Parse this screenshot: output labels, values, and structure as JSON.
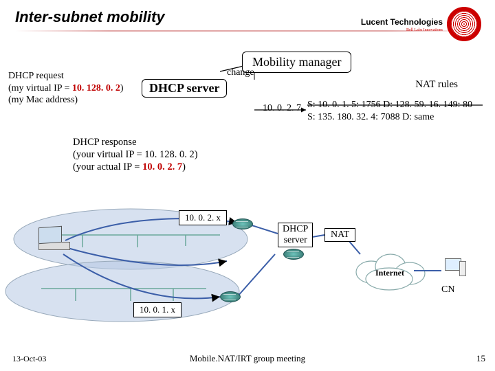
{
  "title": "Inter-subnet mobility",
  "logo": {
    "text": "Lucent Technologies",
    "sub": "Bell Labs Innovations"
  },
  "mobility_box": "Mobility manager",
  "dhcp_box": "DHCP server",
  "change_label": "change",
  "dhcp_request": {
    "l1": "DHCP request",
    "l2a": "(my virtual IP = ",
    "l2b_red": "10. 128. 0. 2",
    "l2c": ")",
    "l3": "(my Mac address)"
  },
  "nat_rules_label": "NAT rules",
  "nat_lines": {
    "l1": "S: 10. 0. 1. 5: 1756  D: 128. 59. 16. 149: 80",
    "l2": "S: 135. 180. 32. 4: 7088  D: same"
  },
  "ip_addr": "10. 0. 2. 7",
  "dhcp_response": {
    "l1": "DHCP response",
    "l2": "(your virtual IP = 10. 128. 0. 2)",
    "l3a": "(your actual IP = ",
    "l3b_red": "10. 0. 2. 7",
    "l3c": ")"
  },
  "subnets": {
    "s1": "10. 0. 2. x",
    "s2": "10. 0. 1. x"
  },
  "dhcp_srv": {
    "l1": "DHCP",
    "l2": "server"
  },
  "nat_box": "NAT",
  "internet": "Internet",
  "cn": "CN",
  "footer": {
    "date": "13-Oct-03",
    "center": "Mobile.NAT/IRT group meeting",
    "page": "15"
  }
}
